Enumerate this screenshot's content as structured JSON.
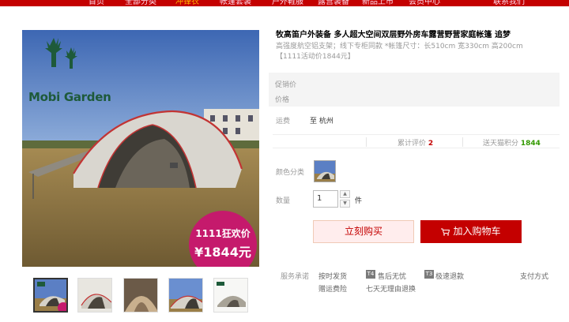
{
  "nav": {
    "items": [
      "首页",
      "全部分类",
      "冲锋衣",
      "帐篷套装",
      "户外鞋服",
      "露营装备",
      "新品上市",
      "会员中心",
      "联系我们"
    ],
    "hot_index": 2
  },
  "gallery": {
    "logo_text": "Mobi Garden",
    "promo_line1": "1111狂欢价",
    "promo_line2": "¥1844元",
    "thumbnail_count": 5,
    "active_thumbnail": 0
  },
  "product": {
    "title": "牧高笛户外装备 多人超大空间双层野外房车露营野营家庭帐篷 追梦",
    "subtitle": "高强度航空铝支架；线下专柜同款 *帐篷尺寸：长510cm 宽330cm 高200cm【1111活动价1844元】"
  },
  "price": {
    "promo_label": "促销价",
    "price_label": "价格"
  },
  "shipping": {
    "label": "运费",
    "value": "至 杭州"
  },
  "stats": {
    "review_label": "累计评价",
    "review_count": "2",
    "points_label": "送天猫积分",
    "points_value": "1844"
  },
  "options": {
    "color_label": "颜色分类",
    "qty_label": "数量",
    "qty_value": "1",
    "qty_unit": "件",
    "up_glyph": "▲",
    "down_glyph": "▼"
  },
  "actions": {
    "buy_label": "立刻购买",
    "cart_label": "加入购物车"
  },
  "services": {
    "label": "服务承诺",
    "items": [
      "按时发货",
      "售后无忧",
      "极速退款",
      "赠运费险",
      "七天无理由退换"
    ],
    "tag_t4": "T4",
    "tag_t3": "T3",
    "pay_label": "支付方式"
  },
  "colors": {
    "accent": "#c40000",
    "promo_badge": "#c51a6c",
    "points_green": "#339900"
  }
}
